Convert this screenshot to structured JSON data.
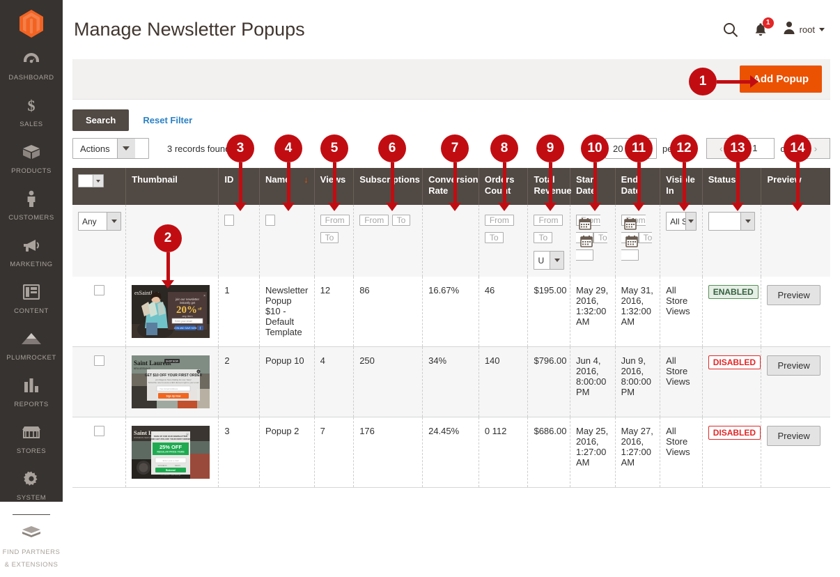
{
  "sidebar": {
    "logo_name": "magento-logo",
    "items": [
      {
        "label": "DASHBOARD",
        "icon": "dashboard-icon"
      },
      {
        "label": "SALES",
        "icon": "dollar-icon"
      },
      {
        "label": "PRODUCTS",
        "icon": "box-icon"
      },
      {
        "label": "CUSTOMERS",
        "icon": "person-icon"
      },
      {
        "label": "MARKETING",
        "icon": "megaphone-icon"
      },
      {
        "label": "CONTENT",
        "icon": "layout-icon"
      },
      {
        "label": "PLUMROCKET",
        "icon": "pyramid-icon"
      },
      {
        "label": "REPORTS",
        "icon": "bar-chart-icon"
      },
      {
        "label": "STORES",
        "icon": "storefront-icon"
      },
      {
        "label": "SYSTEM",
        "icon": "gear-icon"
      }
    ],
    "footer_item": {
      "label": "FIND PARTNERS\n& EXTENSIONS",
      "label_line1": "FIND PARTNERS",
      "label_line2": "& EXTENSIONS",
      "icon": "extensions-icon"
    }
  },
  "header": {
    "title": "Manage Newsletter Popups",
    "search_icon": "search-icon",
    "notification_icon": "bell-icon",
    "notification_count": "1",
    "user_icon": "user-avatar-icon",
    "user_name": "root"
  },
  "page_actions": {
    "add_popup_label": "Add Popup"
  },
  "toolbar": {
    "search_label": "Search",
    "reset_filter_label": "Reset Filter",
    "actions_label": "Actions",
    "records_found": "3 records found",
    "per_page_value": "20",
    "per_page_label": "per page",
    "prev_label": "‹",
    "next_label": "›",
    "page_value": "1",
    "of_pages": "of 1"
  },
  "grid": {
    "columns": [
      {
        "label": "",
        "name": "massaction"
      },
      {
        "label": "Thumbnail",
        "name": "thumbnail"
      },
      {
        "label": "ID",
        "name": "id"
      },
      {
        "label": "Name",
        "name": "name",
        "sorted": "↓"
      },
      {
        "label": "Views",
        "name": "views"
      },
      {
        "label": "Subscriptions",
        "name": "subscriptions"
      },
      {
        "label": "Conversion Rate",
        "name": "conversion-rate"
      },
      {
        "label": "Orders Count",
        "name": "orders-count"
      },
      {
        "label": "Total Revenue",
        "name": "total-revenue"
      },
      {
        "label": "Start Date",
        "name": "start-date"
      },
      {
        "label": "End Date",
        "name": "end-date"
      },
      {
        "label": "Visible In",
        "name": "visible-in"
      },
      {
        "label": "Status",
        "name": "status"
      },
      {
        "label": "Preview",
        "name": "preview"
      }
    ],
    "filters": {
      "massaction_value": "Any",
      "id_value": "",
      "name_value": "",
      "views_from": "From",
      "views_to": "To",
      "subscriptions_from": "From",
      "subscriptions_to": "To",
      "orders_from": "From",
      "orders_to": "To",
      "revenue_from": "From",
      "revenue_to": "To",
      "revenue_currency": "U",
      "start_from": "From",
      "start_to": "To",
      "end_from": "From",
      "end_to": "To",
      "visible_in_value": "All S",
      "status_value": ""
    },
    "rows": [
      {
        "id": "1",
        "name": "Newsletter Popup $10 - Default Template",
        "views": "12",
        "subscriptions": "86",
        "conversion_rate": "16.67%",
        "orders_count": "46",
        "total_revenue": "$195.00",
        "start_date": "May 29, 2016, 1:32:00 AM",
        "end_date": "May 31, 2016, 1:32:00 AM",
        "visible_in": "All Store Views",
        "status": "ENABLED",
        "status_type": "enabled",
        "preview_label": "Preview",
        "thumbnail_name": "popup-thumbnail-20-percent-off"
      },
      {
        "id": "2",
        "name": "Popup 10",
        "views": "4",
        "subscriptions": "250",
        "conversion_rate": "34%",
        "orders_count": "140",
        "total_revenue": "$796.00",
        "start_date": "Jun 4, 2016, 8:00:00 PM",
        "end_date": "Jun 9, 2016, 8:00:00 PM",
        "visible_in": "All Store Views",
        "status": "DISABLED",
        "status_type": "disabled",
        "preview_label": "Preview",
        "thumbnail_name": "popup-thumbnail-10-off-first-order"
      },
      {
        "id": "3",
        "name": "Popup 2",
        "views": "7",
        "subscriptions": "176",
        "conversion_rate": "24.45%",
        "orders_count": "0 112",
        "total_revenue": "$686.00",
        "start_date": "May 25, 2016, 1:27:00 AM",
        "end_date": "May 27, 2016, 1:27:00 AM",
        "visible_in": "All Store Views",
        "status": "DISABLED",
        "status_type": "disabled",
        "preview_label": "Preview",
        "thumbnail_name": "popup-thumbnail-25-percent-off"
      }
    ]
  },
  "annotations": [
    {
      "number": "1",
      "direction": "right"
    },
    {
      "number": "2",
      "direction": "down"
    },
    {
      "number": "3",
      "direction": "down"
    },
    {
      "number": "4",
      "direction": "down"
    },
    {
      "number": "5",
      "direction": "down"
    },
    {
      "number": "6",
      "direction": "down"
    },
    {
      "number": "7",
      "direction": "down"
    },
    {
      "number": "8",
      "direction": "down"
    },
    {
      "number": "9",
      "direction": "down"
    },
    {
      "number": "10",
      "direction": "down"
    },
    {
      "number": "11",
      "direction": "down"
    },
    {
      "number": "12",
      "direction": "down"
    },
    {
      "number": "13",
      "direction": "down"
    },
    {
      "number": "14",
      "direction": "down"
    }
  ],
  "colors": {
    "brand_orange": "#eb5202",
    "sidebar_bg": "#373330",
    "table_header_bg": "#514943",
    "annotation_red": "#c10d12",
    "link_blue": "#2a81c4",
    "enabled_green": "#5b8c5a",
    "disabled_red": "#e22626"
  }
}
